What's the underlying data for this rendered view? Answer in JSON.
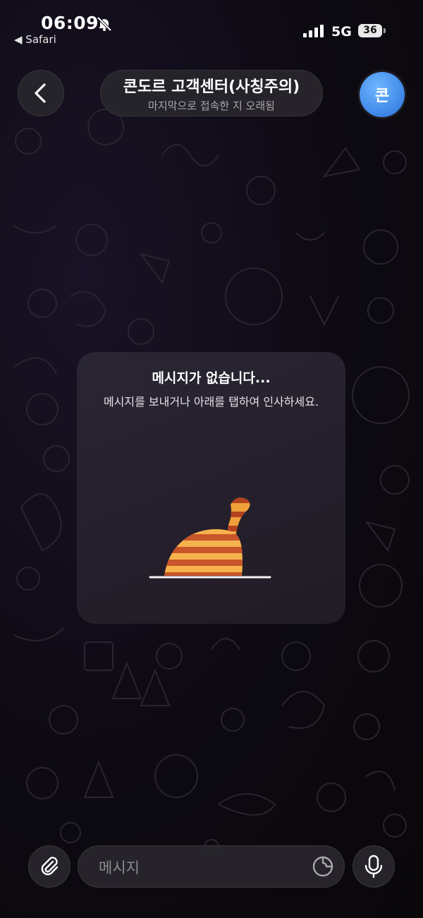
{
  "status_bar": {
    "time": "06:09",
    "back_app": "◀ Safari",
    "network": "5G",
    "battery": "36"
  },
  "header": {
    "title": "콘도르 고객센터(사칭주의)",
    "subtitle": "마지막으로 접속한 지 오래됨",
    "avatar_letter": "콘"
  },
  "empty_state": {
    "heading": "메시지가 없습니다...",
    "body": "메시지를 보내거나 아래를 탭하여 인사하세요."
  },
  "composer": {
    "placeholder": "메시지"
  },
  "colors": {
    "accent": "#3d86e8",
    "surface": "#28262c",
    "sticker_orange": "#f0a03a",
    "sticker_stripe": "#b3421f"
  }
}
